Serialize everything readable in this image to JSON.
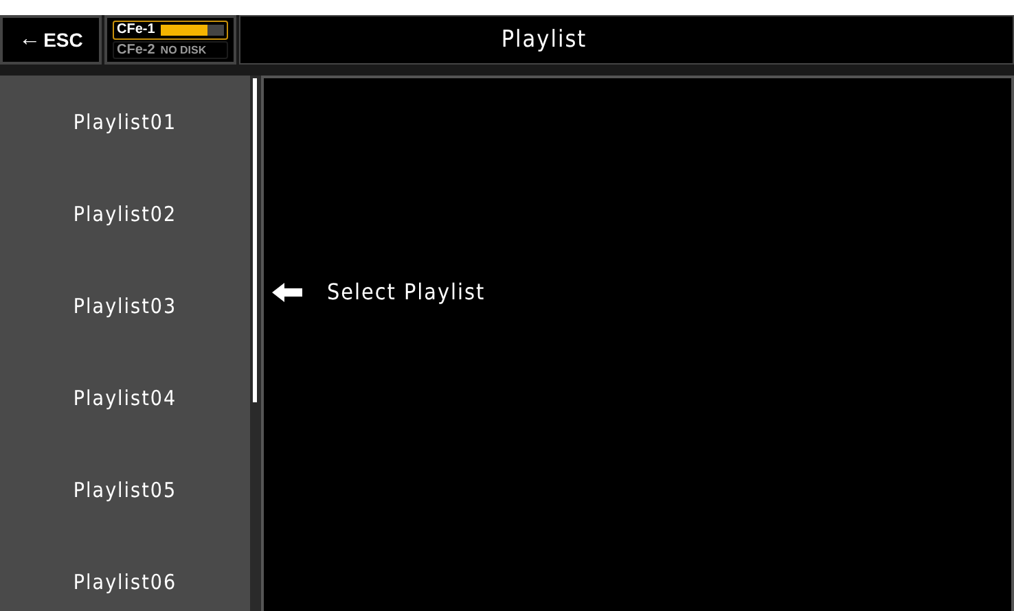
{
  "header": {
    "back_button": {
      "arrow": "←",
      "label": "ESC"
    },
    "media": [
      {
        "name": "CFe-1",
        "level": 0.75,
        "active": true
      },
      {
        "name": "CFe-2",
        "status": "NO DISK",
        "active": false
      }
    ],
    "title": "Playlist"
  },
  "sidebar": {
    "items": [
      {
        "label": "Playlist01"
      },
      {
        "label": "Playlist02"
      },
      {
        "label": "Playlist03"
      },
      {
        "label": "Playlist04"
      },
      {
        "label": "Playlist05"
      },
      {
        "label": "Playlist06"
      }
    ]
  },
  "main": {
    "hint": "Select Playlist"
  }
}
